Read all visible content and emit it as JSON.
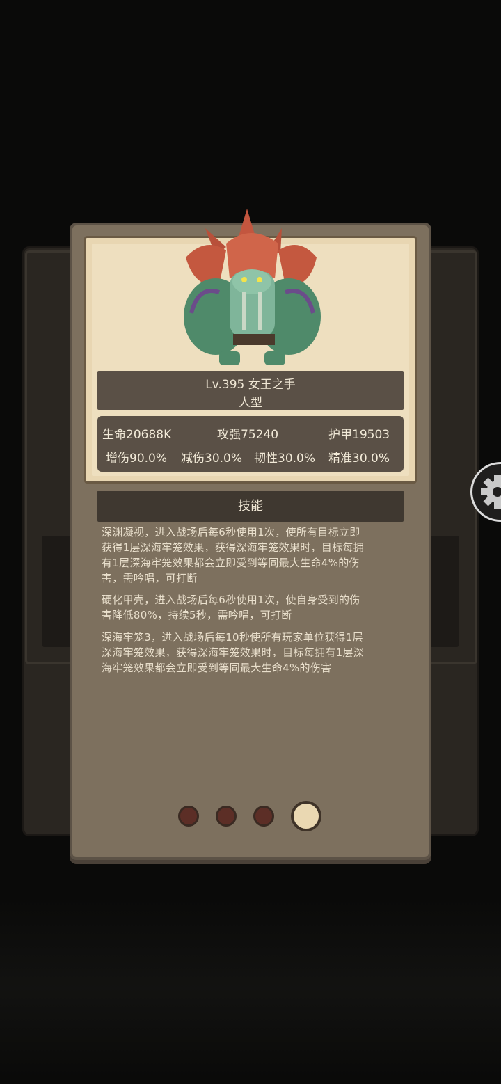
{
  "monster": {
    "name_line": "Lv.395 女王之手",
    "type": "人型"
  },
  "stats": {
    "hp": "生命20688K",
    "attack": "攻强75240",
    "armor": "护甲19503",
    "damage_up": "增伤90.0%",
    "damage_reduction": "减伤30.0%",
    "toughness": "韧性30.0%",
    "accuracy": "精准30.0%"
  },
  "skills": {
    "header": "技能",
    "items": [
      {
        "line1": "深渊凝视，进入战场后每6秒使用1次，使所有目标立即",
        "line2": "获得1层深海牢笼效果，获得深海牢笼效果时，目标每拥",
        "line3": "有1层深海牢笼效果都会立即受到等同最大生命4%的伤",
        "line4": "害，需吟唱，可打断"
      },
      {
        "line1": "硬化甲壳，进入战场后每6秒使用1次，使自身受到的伤",
        "line2": "害降低80%，持续5秒，需吟唱，可打断"
      },
      {
        "line1": "深海牢笼3，进入战场后每10秒使所有玩家单位获得1层",
        "line2": "深海牢笼效果，获得深海牢笼效果时，目标每拥有1层深",
        "line3": "海牢笼效果都会立即受到等同最大生命4%的伤害"
      }
    ]
  },
  "pagination": {
    "count": 4,
    "active_index": 3
  },
  "icons": {
    "side_button": "gear-icon"
  },
  "colors": {
    "card_bg": "#7d705e",
    "frame_bg": "#e8d6b2",
    "plate_bg": "#5a5046",
    "dot_active": "#ead8b2",
    "dot_inactive": "#5c2e26"
  }
}
